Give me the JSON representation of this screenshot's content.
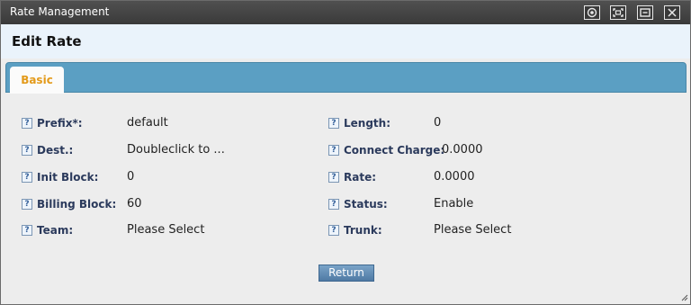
{
  "window": {
    "title": "Rate Management"
  },
  "titlebar_buttons": [
    {
      "icon": "settings-icon"
    },
    {
      "icon": "maximize-icon"
    },
    {
      "icon": "restore-icon"
    },
    {
      "icon": "close-icon"
    }
  ],
  "page": {
    "title": "Edit Rate"
  },
  "tabs": [
    {
      "label": "Basic",
      "active": true
    }
  ],
  "form": {
    "left": [
      {
        "label": "Prefix*:",
        "value": "default"
      },
      {
        "label": "Dest.:",
        "value": "Doubleclick to ..."
      },
      {
        "label": "Init Block:",
        "value": "0"
      },
      {
        "label": "Billing Block:",
        "value": "60"
      },
      {
        "label": "Team:",
        "value": "Please Select"
      }
    ],
    "right": [
      {
        "label": "Length:",
        "value": "0"
      },
      {
        "label": "Connect Charge:",
        "value": "0.0000"
      },
      {
        "label": "Rate:",
        "value": "0.0000"
      },
      {
        "label": "Status:",
        "value": "Enable"
      },
      {
        "label": "Trunk:",
        "value": "Please Select"
      }
    ]
  },
  "actions": {
    "return_label": "Return"
  },
  "colors": {
    "tab_bar": "#5b9fc3",
    "tab_label": "#e39a1a",
    "label": "#2b3a5c"
  }
}
